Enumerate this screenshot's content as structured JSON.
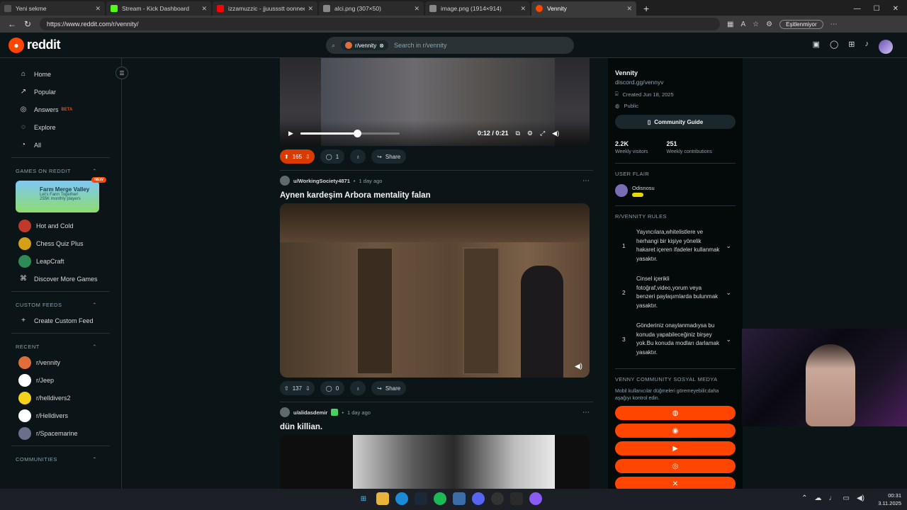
{
  "browser": {
    "tabs": [
      {
        "title": "Yeni sekme",
        "active": false,
        "color": "#555555"
      },
      {
        "title": "Stream - Kick Dashboard",
        "active": false,
        "color": "#53fc18"
      },
      {
        "title": "izzamuzzic - jjuussstt oonnee (slo…",
        "active": false,
        "color": "#ff0000"
      },
      {
        "title": "alci.png (307×50)",
        "active": false,
        "color": "#888888"
      },
      {
        "title": "image.png (1914×914)",
        "active": false,
        "color": "#888888"
      },
      {
        "title": "Vennity",
        "active": true,
        "color": "#ff4500"
      }
    ],
    "url": "https://www.reddit.com/r/vennity/",
    "sync_label": "Eşitlenmiyor"
  },
  "header": {
    "logo_text": "reddit",
    "search_chip": "r/vennity",
    "search_placeholder": "Search in r/vennity"
  },
  "sidebar": {
    "nav": [
      {
        "label": "Home",
        "icon": "home-icon",
        "glyph": "⌂"
      },
      {
        "label": "Popular",
        "icon": "popular-icon",
        "glyph": "↗"
      },
      {
        "label": "Answers",
        "icon": "answers-icon",
        "glyph": "◎"
      },
      {
        "label": "Explore",
        "icon": "explore-icon",
        "glyph": "◌"
      },
      {
        "label": "All",
        "icon": "all-icon",
        "glyph": "◔"
      }
    ],
    "answers_badge": "BETA",
    "games_header": "GAMES ON REDDIT",
    "featured_game": {
      "title": "Farm Merge Valley",
      "subtitle": "Let's Farm Together!",
      "stat": "255K monthly players",
      "badge": "NEW"
    },
    "games": [
      {
        "label": "Hot and Cold",
        "color": "#c0392b"
      },
      {
        "label": "Chess Quiz Plus",
        "color": "#d4a017"
      },
      {
        "label": "LeapCraft",
        "color": "#2e8b57"
      },
      {
        "label": "Discover More Games",
        "color": ""
      }
    ],
    "custom_feeds_header": "CUSTOM FEEDS",
    "create_feed": "Create Custom Feed",
    "recent_header": "RECENT",
    "recent": [
      {
        "label": "r/vennity",
        "color": "#e06d3a"
      },
      {
        "label": "r/Jeep",
        "color": "#ffffff"
      },
      {
        "label": "r/helldivers2",
        "color": "#f2d21b"
      },
      {
        "label": "r/Helldivers",
        "color": "#ffffff"
      },
      {
        "label": "r/Spacemarine",
        "color": "#6a6f8a"
      }
    ],
    "communities_header": "COMMUNITIES"
  },
  "feed": {
    "post1": {
      "current_time": "0:12 / 0:21",
      "progress": 0.57,
      "upvotes": "165",
      "comments": "1",
      "share": "Share"
    },
    "post2": {
      "author": "u/WorkingSociety4871",
      "age": "1 day ago",
      "title": "Aynen kardeşim Arbora mentality falan",
      "upvotes": "137",
      "comments": "0",
      "share": "Share"
    },
    "post3": {
      "author": "u/alidasdemir",
      "age": "1 day ago",
      "title": "dün killian."
    }
  },
  "community": {
    "name": "Vennity",
    "link": "discord.gg/vennyv",
    "created": "Created Jun 18, 2025",
    "visibility": "Public",
    "guide_label": "Community Guide",
    "visitors": "2.2K",
    "visitors_label": "Weekly visitors",
    "contributions": "251",
    "contributions_label": "Weekly contributions",
    "flair_header": "USER FLAIR",
    "flair_user": "Odisnosu",
    "rules_header": "R/VENNITY RULES",
    "rules": [
      {
        "n": "1",
        "text": "Yayıncılara,whitelistlere ve herhangi bir kişiye yönelik hakaret içeren ifadeler kullanmak yasaktır."
      },
      {
        "n": "2",
        "text": "Cinsel içerikli fotoğraf,video,yorum veya benzeri paylaşımlarda bulunmak yasaktır."
      },
      {
        "n": "3",
        "text": "Gönderiniz onaylanmadıysa bu konuda yapabileceğiniz birşey yok.Bu konuda modları darlamak yasaktır."
      }
    ],
    "social_header": "VENNY COMMUNITY SOSYAL MEDYA",
    "social_note": "Mobil kullanıcılar düğmeleri göremeyebilir;daha aşağıyı kontrol edin.",
    "social_buttons": [
      "web",
      "discord",
      "youtube",
      "instagram",
      "x"
    ]
  },
  "taskbar": {
    "time": "00:31",
    "date": "3.11.2025"
  },
  "colors": {
    "accent": "#ff4500",
    "background": "#0b1416",
    "upvote_active": "#d93a00"
  }
}
